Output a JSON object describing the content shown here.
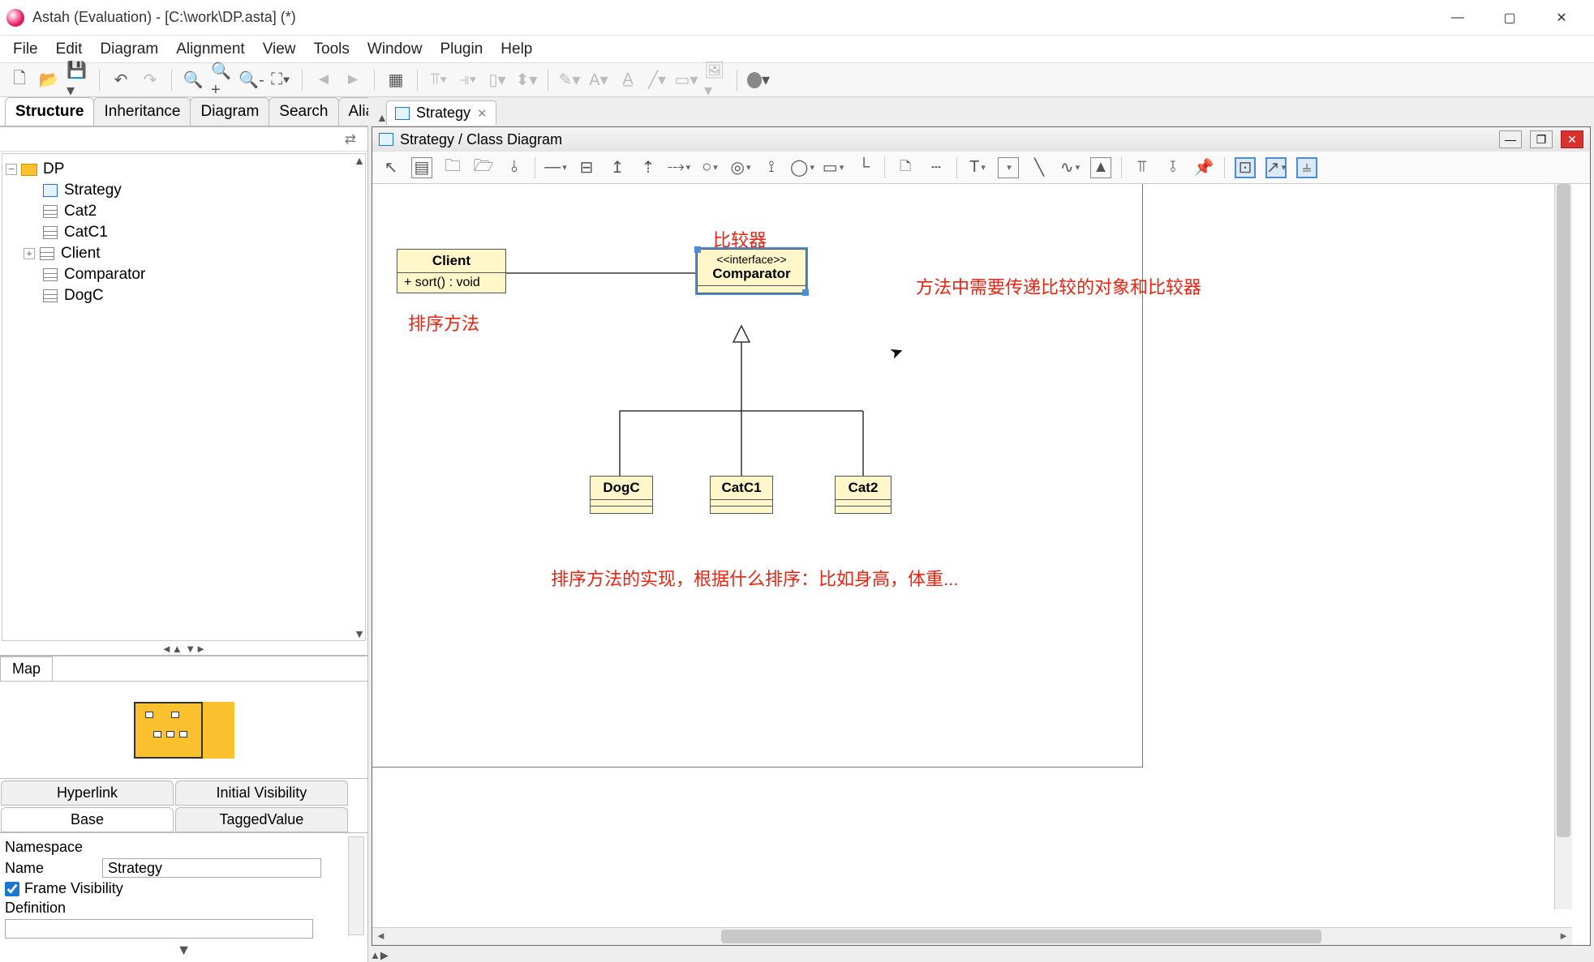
{
  "window": {
    "title": "Astah (Evaluation) - [C:\\work\\DP.asta] (*)"
  },
  "menu": [
    "File",
    "Edit",
    "Diagram",
    "Alignment",
    "View",
    "Tools",
    "Window",
    "Plugin",
    "Help"
  ],
  "leftTabs": [
    "Structure",
    "Inheritance",
    "Diagram",
    "Search",
    "Alias"
  ],
  "tree": {
    "root": "DP",
    "children": [
      "Strategy",
      "Cat2",
      "CatC1",
      "Client",
      "Comparator",
      "DogC"
    ]
  },
  "mapTab": "Map",
  "propTabs": {
    "row1": [
      "Hyperlink",
      "Initial Visibility"
    ],
    "row2": [
      "Base",
      "TaggedValue"
    ]
  },
  "props": {
    "namespaceLabel": "Namespace",
    "nameLabel": "Name",
    "nameValue": "Strategy",
    "frameVisLabel": "Frame Visibility",
    "frameVisChecked": true,
    "definitionLabel": "Definition"
  },
  "docTab": {
    "label": "Strategy"
  },
  "diagramTitle": "Strategy / Class Diagram",
  "uml": {
    "client": {
      "name": "Client",
      "op": "+ sort() : void"
    },
    "comparator": {
      "stereo": "<<interface>>",
      "name": "Comparator"
    },
    "dogc": "DogC",
    "catc1": "CatC1",
    "cat2": "Cat2"
  },
  "annotations": {
    "comparatorLabel": "比较器",
    "sortMethod": "排序方法",
    "methodNote": "方法中需要传递比较的对象和比较器",
    "implNote": "排序方法的实现，根据什么排序：比如身高，体重..."
  }
}
